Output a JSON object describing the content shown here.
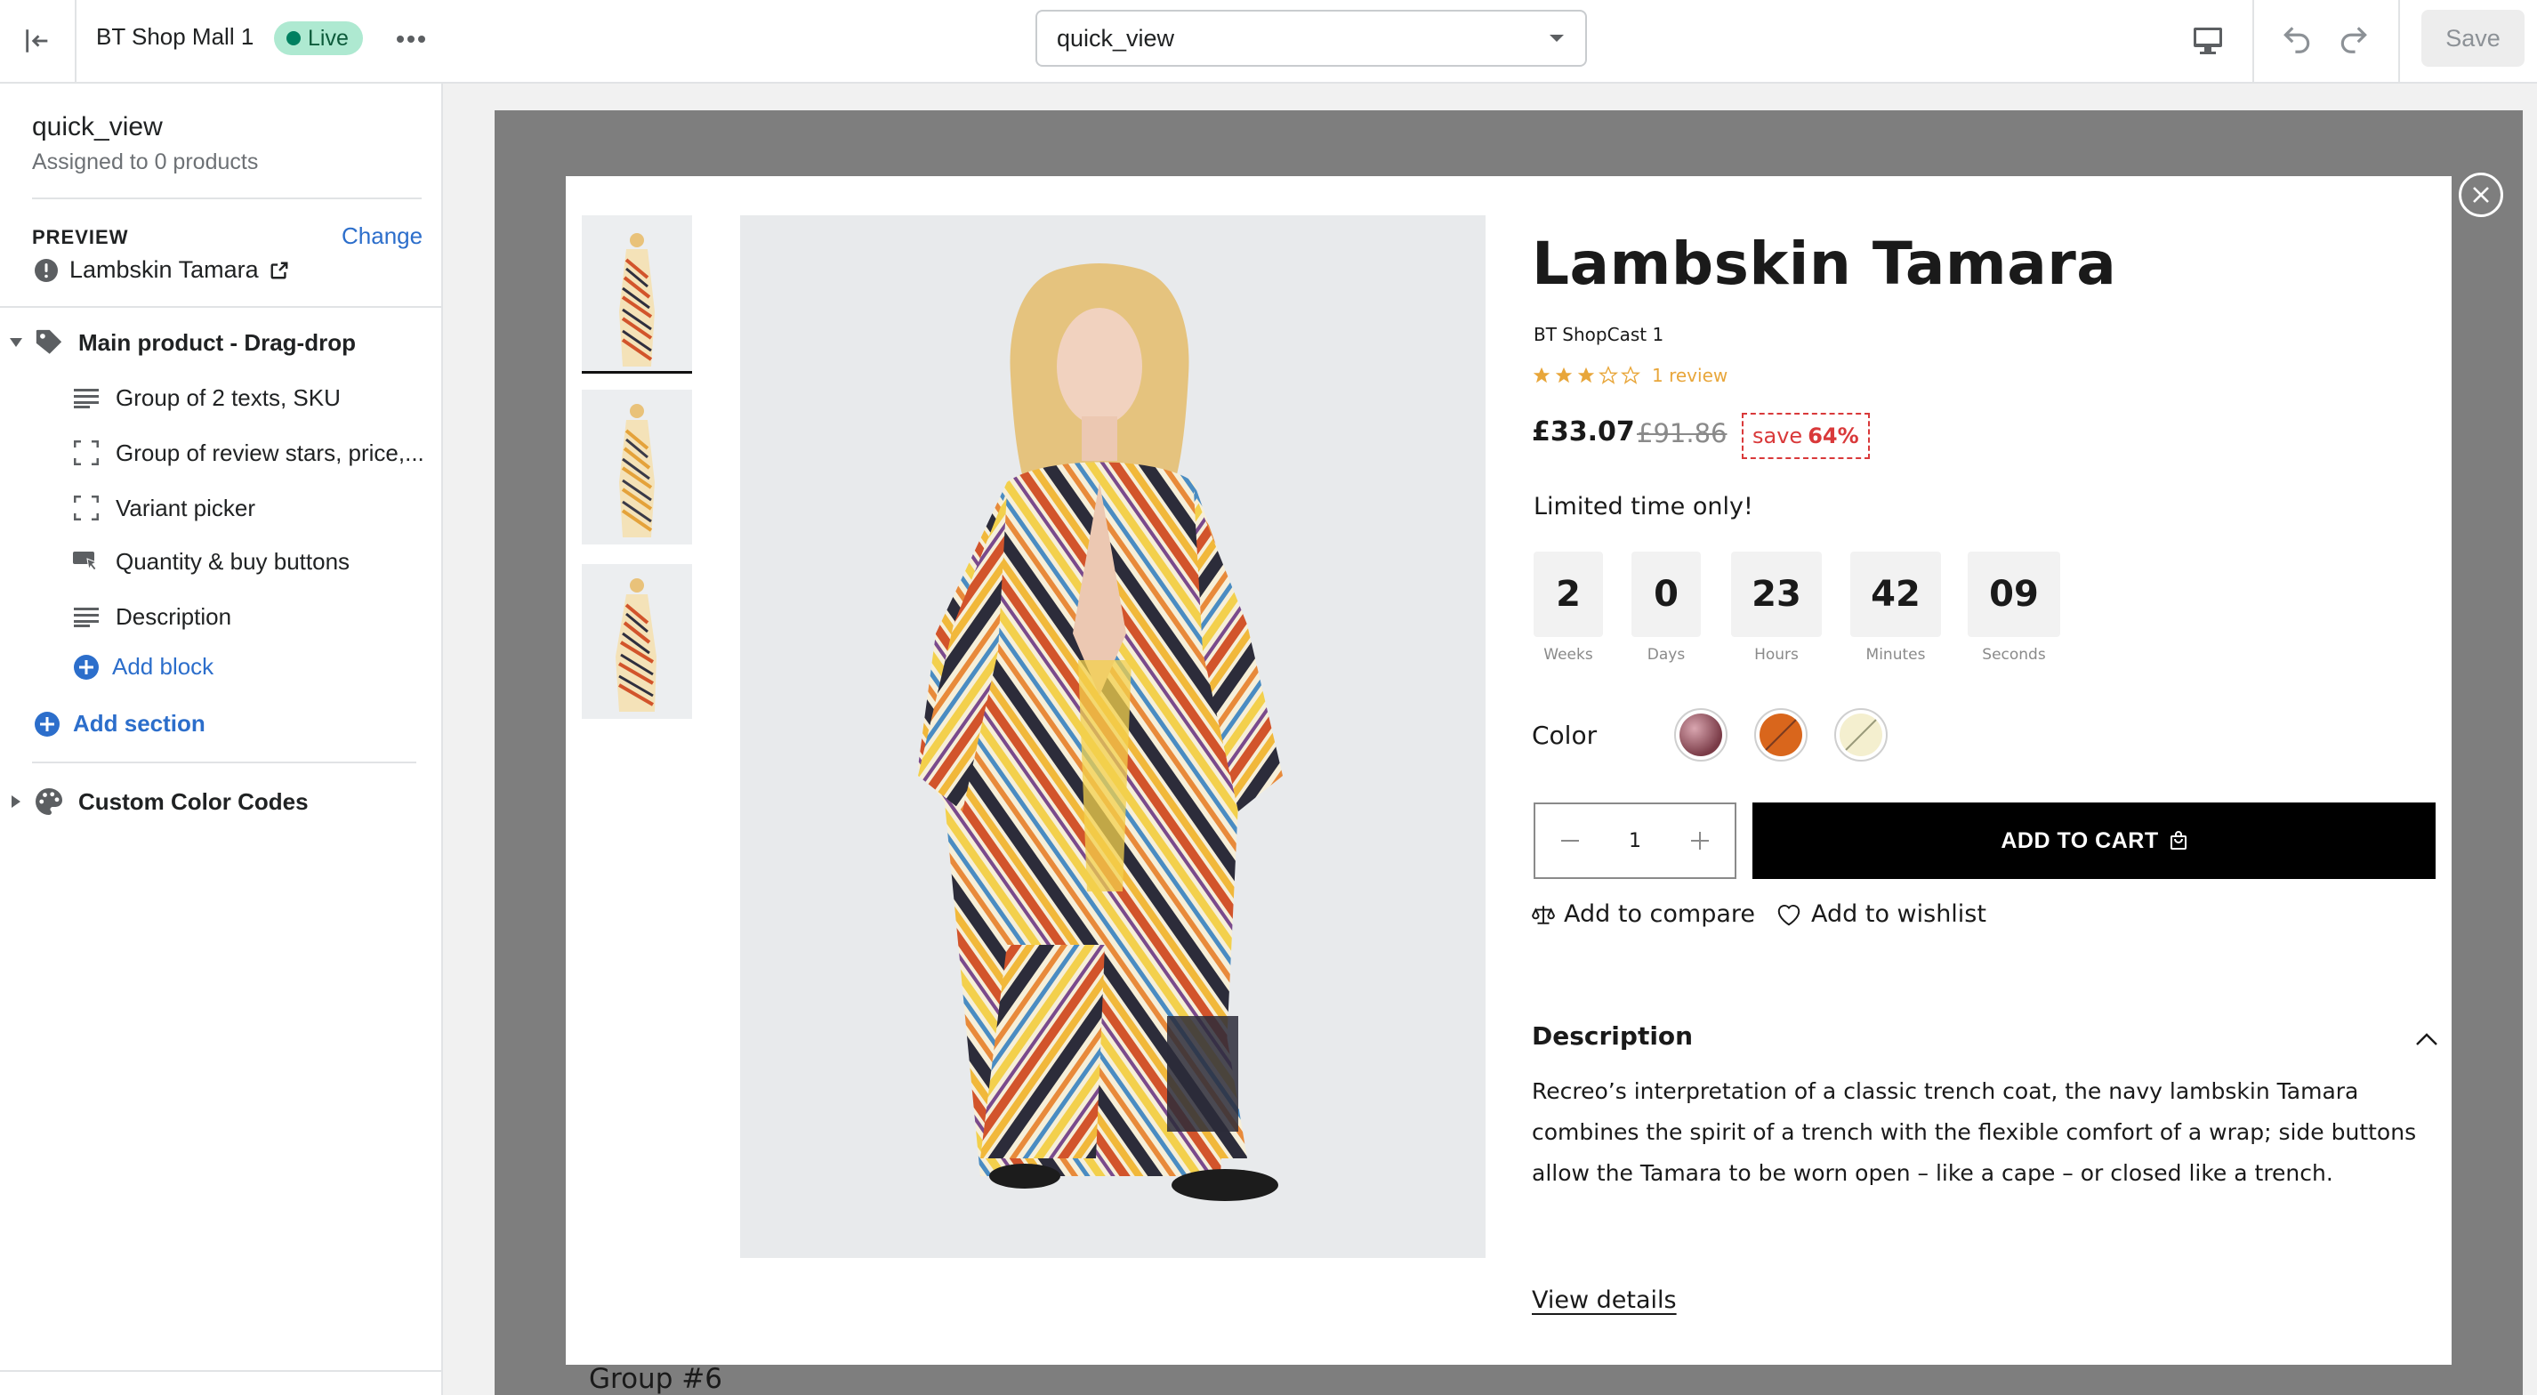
{
  "topbar": {
    "exit_icon": "exit-icon",
    "store_name": "BT Shop Mall 1",
    "status_badge": "Live",
    "more_icon": "more-horizontal-icon",
    "template_select": {
      "value": "quick_view"
    },
    "device_icon": "desktop-icon",
    "undo_icon": "undo-icon",
    "redo_icon": "redo-icon",
    "save_label": "Save"
  },
  "sidebar": {
    "title": "quick_view",
    "subtitle": "Assigned to 0 products",
    "preview_label": "PREVIEW",
    "change_label": "Change",
    "preview_product": "Lambskin Tamara",
    "section": {
      "label": "Main product - Drag-drop",
      "icon": "tag-icon",
      "blocks": [
        {
          "label": "Group of 2 texts, SKU",
          "icon": "text-lines-icon"
        },
        {
          "label": "Group of review stars, price,...",
          "icon": "dashed-square-icon"
        },
        {
          "label": "Variant picker",
          "icon": "dashed-square-icon"
        },
        {
          "label": "Quantity & buy buttons",
          "icon": "buy-button-icon"
        },
        {
          "label": "Description",
          "icon": "text-lines-icon"
        }
      ],
      "add_block": "Add block"
    },
    "add_section": "Add section",
    "custom_section": {
      "label": "Custom Color Codes",
      "icon": "palette-icon"
    }
  },
  "preview": {
    "behind_text": "Group #6",
    "product": {
      "title": "Lambskin Tamara",
      "vendor": "BT ShopCast 1",
      "rating": 3,
      "rating_max": 5,
      "review_text": "1 review",
      "price": "£33.07",
      "compare_price": "£91.86",
      "save_prefix": "save",
      "save_amount": "64%",
      "limited_text": "Limited time only!",
      "countdown": [
        {
          "value": "2",
          "label": "Weeks"
        },
        {
          "value": "0",
          "label": "Days"
        },
        {
          "value": "23",
          "label": "Hours"
        },
        {
          "value": "42",
          "label": "Minutes"
        },
        {
          "value": "09",
          "label": "Seconds"
        }
      ],
      "color_label": "Color",
      "swatches": [
        {
          "name": "maroon-swatch",
          "color": "#7a3b47"
        },
        {
          "name": "orange-swatch",
          "color": "#d9661c"
        },
        {
          "name": "cream-swatch",
          "color": "#f4efcf"
        }
      ],
      "quantity": "1",
      "add_to_cart": "ADD TO CART",
      "compare_label": "Add to compare",
      "wishlist_label": "Add to wishlist",
      "description_heading": "Description",
      "description_text": "Recreo’s interpretation of a classic trench coat, the navy lambskin Tamara combines the spirit of a trench with the flexible comfort of a wrap; side buttons allow the Tamara to be worn open – like a cape – or closed like a trench.",
      "view_details": "View details"
    }
  },
  "colors": {
    "accent": "#2c6ecb",
    "live_badge_bg": "#aee9d1",
    "live_dot": "#008060",
    "save_red": "#d9393a",
    "star": "#e8a63a",
    "canvas_bg": "#7e7e7e"
  }
}
